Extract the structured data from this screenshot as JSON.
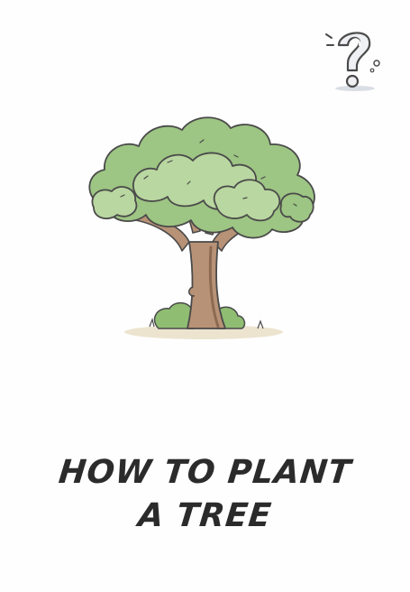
{
  "icons": {
    "question": "question-mark-icon",
    "tree": "tree-illustration"
  },
  "colors": {
    "title_text": "#2b2b2b",
    "foliage_light": "#b9d7a0",
    "foliage_mid": "#9dc583",
    "foliage_dark": "#7fae68",
    "trunk": "#b89276",
    "trunk_shadow": "#8c6a52",
    "outline": "#4a4a4a",
    "ground": "#ece4cf",
    "question_fill": "#eef0f4"
  },
  "title": {
    "line1": "HOW TO PLANT",
    "line2": "A TREE"
  }
}
